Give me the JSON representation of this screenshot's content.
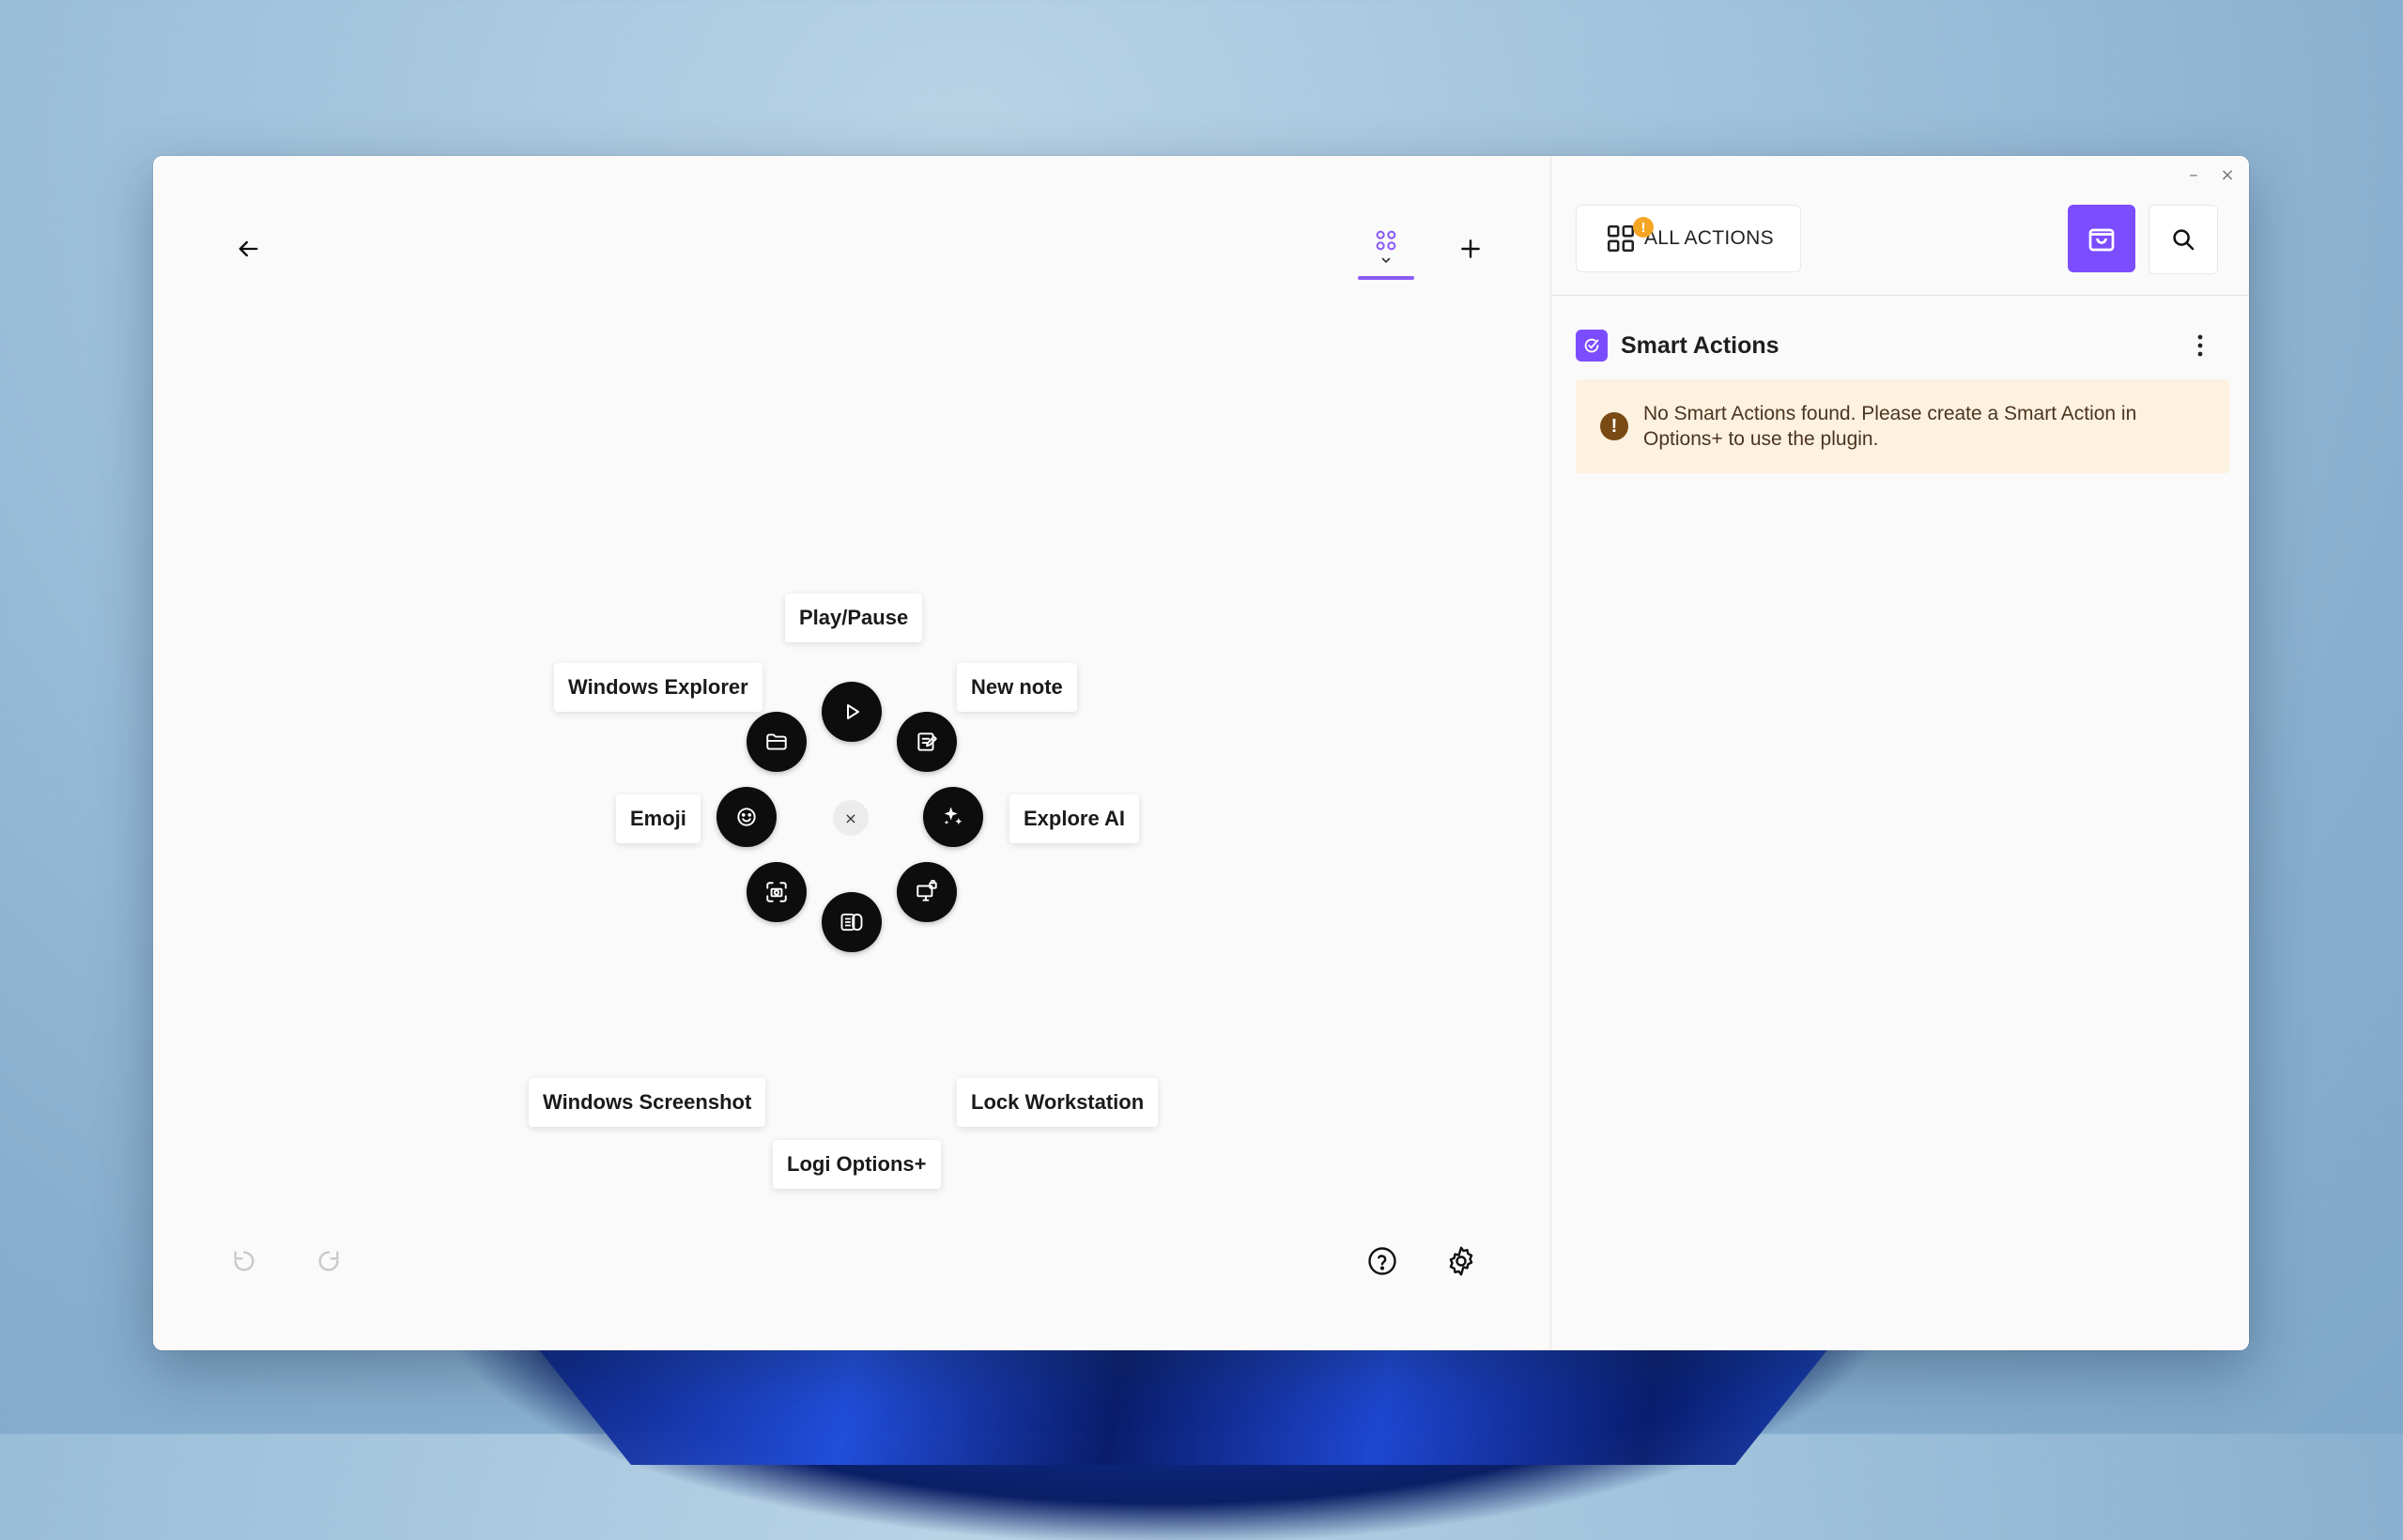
{
  "window": {
    "controls": {
      "minimize": "–",
      "close": "×"
    }
  },
  "editor": {
    "back_icon": "arrow-left-icon",
    "layout_icon": "grid-dots-icon",
    "add_icon": "plus-icon",
    "center_close": "×",
    "actions": [
      {
        "name": "play-pause",
        "label": "Play/Pause",
        "icon": "play-icon"
      },
      {
        "name": "new-note",
        "label": "New note",
        "icon": "note-edit-icon"
      },
      {
        "name": "explore-ai",
        "label": "Explore AI",
        "icon": "sparkles-icon"
      },
      {
        "name": "lock-workstation",
        "label": "Lock Workstation",
        "icon": "monitor-lock-icon"
      },
      {
        "name": "logi-options",
        "label": "Logi Options+",
        "icon": "logi-options-icon"
      },
      {
        "name": "windows-screenshot",
        "label": "Windows Screenshot",
        "icon": "screenshot-icon"
      },
      {
        "name": "emoji",
        "label": "Emoji",
        "icon": "smiley-icon"
      },
      {
        "name": "windows-explorer",
        "label": "Windows Explorer",
        "icon": "folder-icon"
      }
    ],
    "footer": {
      "undo_icon": "undo-icon",
      "redo_icon": "redo-icon",
      "help_icon": "help-circle-icon",
      "settings_icon": "gear-icon"
    }
  },
  "sidebar": {
    "all_actions_label": "ALL ACTIONS",
    "all_actions_badge": "!",
    "store_icon": "shopping-bag-icon",
    "search_icon": "search-icon",
    "section_title": "Smart Actions",
    "section_menu_icon": "kebab-icon",
    "alert_icon_text": "!",
    "alert_message": "No Smart Actions found. Please create a Smart Action in Options+ to use the plugin.",
    "accent_color": "#7c4dff"
  }
}
